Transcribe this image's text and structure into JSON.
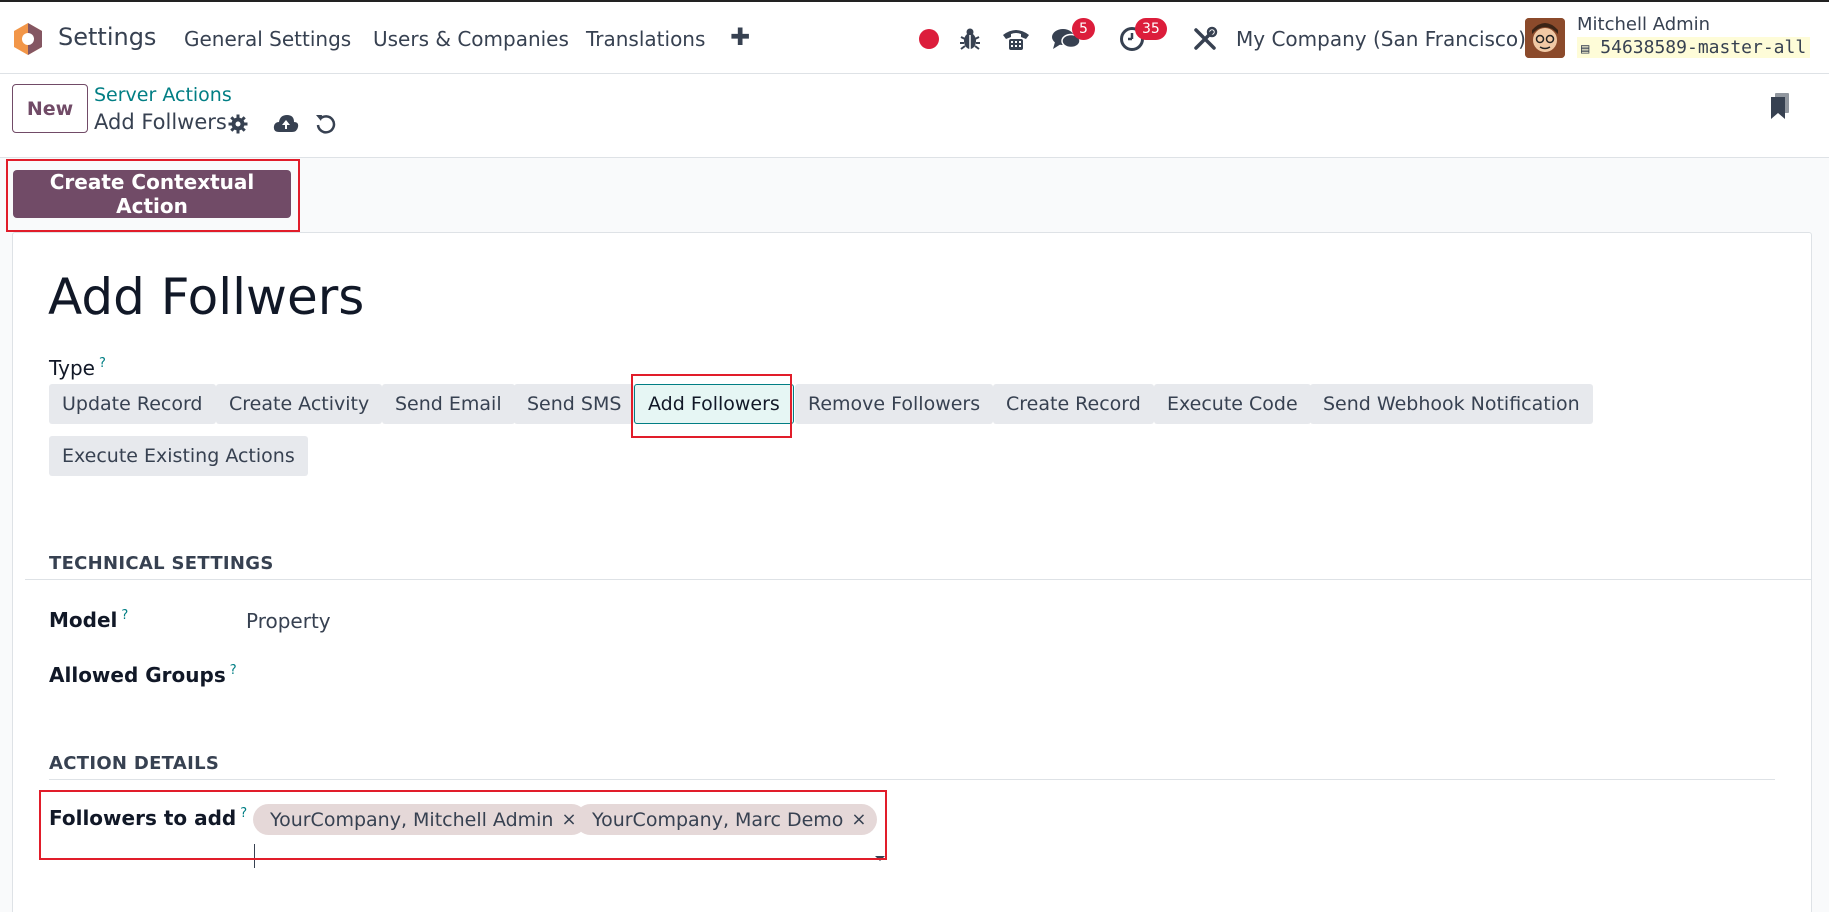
{
  "navbar": {
    "app_name": "Settings",
    "menu": [
      "General Settings",
      "Users & Companies",
      "Translations"
    ],
    "plus": "✚",
    "messages_count": "5",
    "activities_count": "35",
    "company": "My Company (San Francisco)",
    "user_name": "Mitchell Admin",
    "database": "54638589-master-all",
    "logo_colors": {
      "orange": "#f29648",
      "purple": "#714b67",
      "inner": "#ffffff"
    },
    "icons": [
      "record-dot-icon",
      "bug-icon",
      "phone-icon",
      "chat-icon",
      "clock-icon",
      "tools-icon",
      "database-icon",
      "avatar"
    ]
  },
  "control_panel": {
    "new_label": "New",
    "breadcrumb_parent": "Server Actions",
    "breadcrumb_current": "Add Follwers",
    "icons": [
      "gear-icon",
      "cloud-upload-icon",
      "discard-icon",
      "bookmark-icon"
    ]
  },
  "actions": {
    "create_contextual": "Create Contextual Action"
  },
  "form": {
    "title": "Add Follwers",
    "type_label": "Type",
    "help_mark": "?",
    "type_options": [
      "Update Record",
      "Create Activity",
      "Send Email",
      "Send SMS",
      "Add Followers",
      "Remove Followers",
      "Create Record",
      "Execute Code",
      "Send Webhook Notification",
      "Execute Existing Actions"
    ],
    "type_selected": "Add Followers",
    "technical_settings_title": "TECHNICAL SETTINGS",
    "model_label": "Model",
    "model_value": "Property",
    "allowed_groups_label": "Allowed Groups",
    "action_details_title": "ACTION DETAILS",
    "followers_label": "Followers to add",
    "followers": [
      "YourCompany, Mitchell Admin",
      "YourCompany, Marc Demo"
    ],
    "remove_tag": "×"
  },
  "colors": {
    "brand": "#714b67",
    "accent": "#017e84",
    "highlight": "#e11d2a",
    "badge": "#dc1d3b"
  }
}
